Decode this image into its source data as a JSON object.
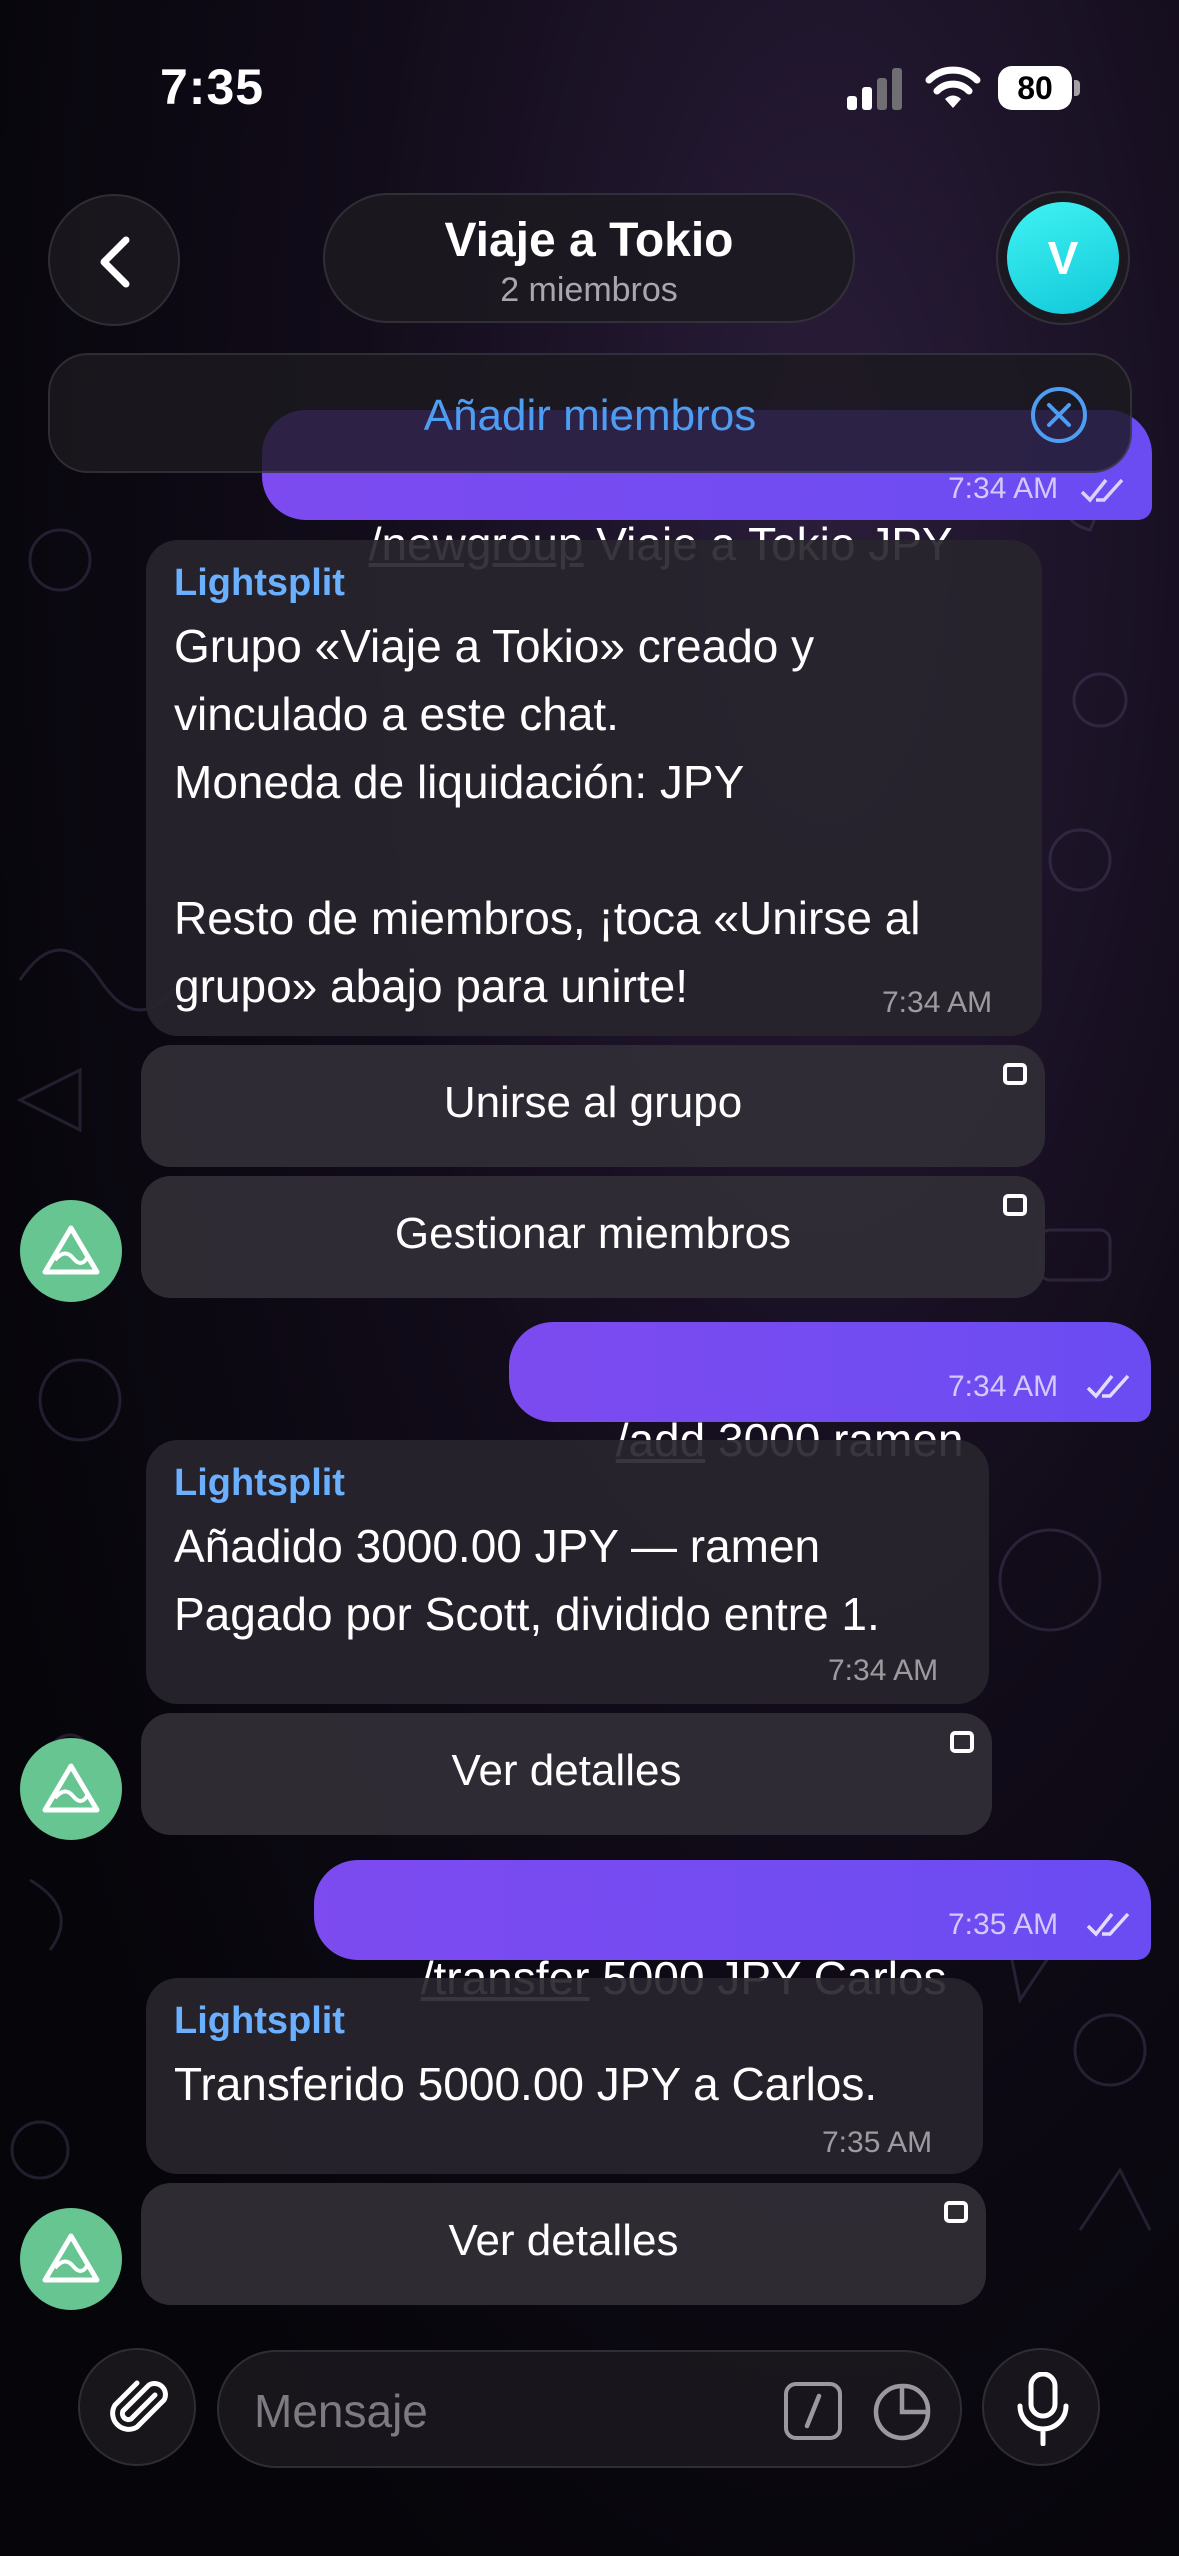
{
  "status_bar": {
    "time": "7:35",
    "battery": "80"
  },
  "header": {
    "title": "Viaje a Tokio",
    "subtitle": "2 miembros",
    "avatar_letter": "V",
    "add_members": "Añadir miembros"
  },
  "messages": {
    "newgroup": {
      "command": "/newgroup",
      "text": " Viaje a Tokio JPY",
      "time": "7:34 AM"
    },
    "created": {
      "sender": "Lightsplit",
      "lines": [
        "Grupo «Viaje a Tokio» creado y",
        "vinculado a este chat.",
        "Moneda de liquidación: JPY",
        "",
        "Resto de miembros, ¡toca «Unirse al",
        "grupo» abajo para unirte!"
      ],
      "time": "7:34 AM",
      "buttons": [
        "Unirse al grupo",
        "Gestionar miembros"
      ]
    },
    "add": {
      "command": "/add",
      "text": " 3000 ramen",
      "time": "7:34 AM"
    },
    "added": {
      "sender": "Lightsplit",
      "lines": [
        "Añadido 3000.00 JPY — ramen",
        "Pagado por Scott, dividido entre 1."
      ],
      "time": "7:34 AM",
      "button": "Ver detalles"
    },
    "transfer": {
      "command": "/transfer",
      "text": " 5000 JPY Carlos",
      "time": "7:35 AM"
    },
    "transferred": {
      "sender": "Lightsplit",
      "lines": [
        "Transferido 5000.00 JPY a Carlos."
      ],
      "time": "7:35 AM",
      "button": "Ver detalles"
    }
  },
  "composer": {
    "placeholder": "Mensaje"
  },
  "colors": {
    "accent": "#4d9df3",
    "outgoing": "#7d4bf0",
    "sender": "#6ab0ff",
    "bot_avatar": "#67c592"
  },
  "icons": [
    "back-chevron-icon",
    "close-circle-icon",
    "attach-icon",
    "commands-icon",
    "sticker-icon",
    "mic-icon",
    "bot-avatar-icon"
  ]
}
